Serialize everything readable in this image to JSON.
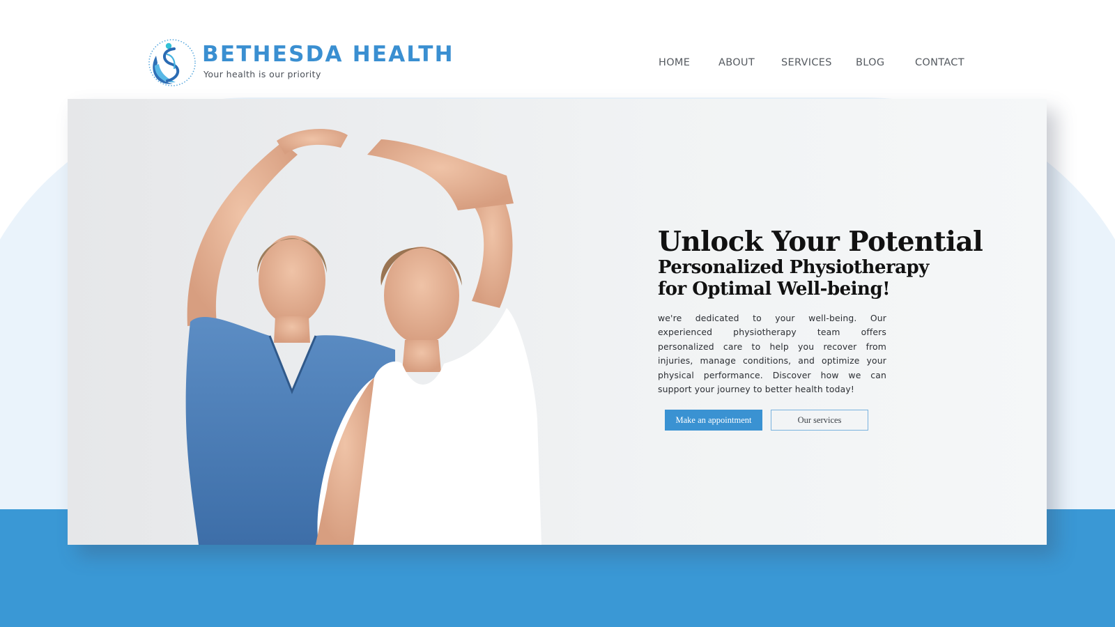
{
  "brand": {
    "name": "BETHESDA HEALTH",
    "tagline": "Your health is our priority",
    "color": "#3a8fd1"
  },
  "nav": {
    "items": [
      {
        "label": "HOME"
      },
      {
        "label": "ABOUT"
      },
      {
        "label": "SERVICES"
      },
      {
        "label": "BLOG"
      },
      {
        "label": "CONTACT"
      }
    ]
  },
  "hero": {
    "title": "Unlock Your Potential",
    "subtitle": "Personalized Physiotherapy for Optimal Well-being!",
    "body": "we're dedicated to your well-being. Our experienced physiotherapy team offers personalized care to help you recover from injuries, manage conditions, and optimize your physical performance. Discover how we can support your journey to better health today!",
    "primary_button": "Make an appointment",
    "secondary_button": "Our services",
    "image": "physiotherapist-stretching-patient-photo"
  },
  "colors": {
    "accent": "#3a92d2",
    "band": "#3a98d5",
    "background_curve": "#eaf3fb"
  }
}
